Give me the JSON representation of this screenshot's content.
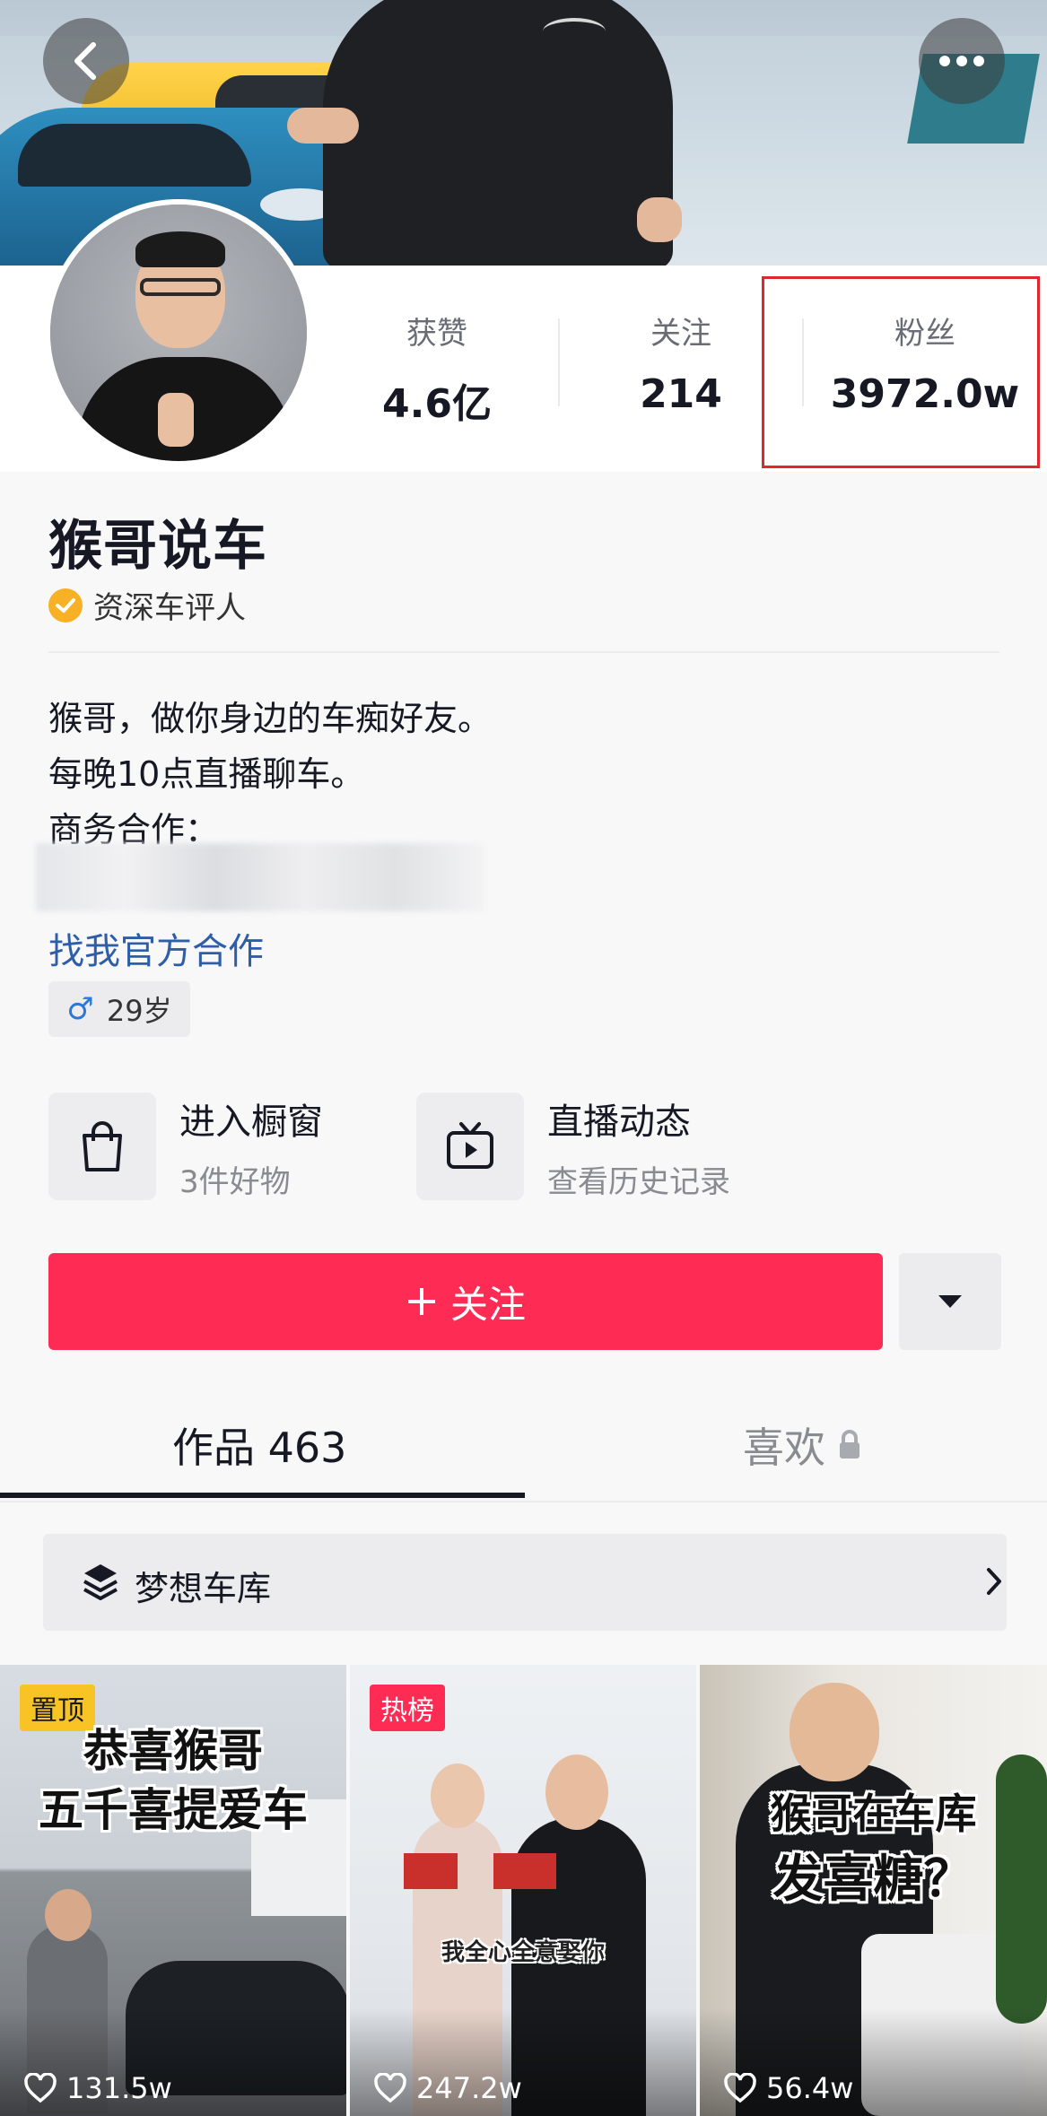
{
  "header": {
    "back_icon": "chevron-left-icon",
    "more_icon": "more-horizontal-icon"
  },
  "stats": [
    {
      "label": "获赞",
      "value": "4.6亿"
    },
    {
      "label": "关注",
      "value": "214"
    },
    {
      "label": "粉丝",
      "value": "3972.0w"
    }
  ],
  "profile": {
    "name": "猴哥说车",
    "verification": "资深车评人",
    "bio_lines": [
      "猴哥，做你身边的车痴好友。",
      "每晚10点直播聊车。",
      "商务合作："
    ],
    "official_link": "找我官方合作",
    "age": "29岁"
  },
  "shortcuts": [
    {
      "title": "进入橱窗",
      "subtitle": "3件好物"
    },
    {
      "title": "直播动态",
      "subtitle": "查看历史记录"
    }
  ],
  "actions": {
    "follow_label": "关注"
  },
  "tabs": {
    "works": "作品 463",
    "likes": "喜欢"
  },
  "collection": {
    "label": "梦想车库"
  },
  "videos": [
    {
      "tag": "置顶",
      "caption_lines": [
        "恭喜猴哥",
        "五千喜提爱车"
      ],
      "likes": "131.5w"
    },
    {
      "tag": "热榜",
      "caption_lines": [
        "我全心全意娶你"
      ],
      "likes": "247.2w"
    },
    {
      "tag": "",
      "caption_lines": [
        "猴哥在车库",
        "发喜糖？"
      ],
      "likes": "56.4w"
    }
  ],
  "colors": {
    "accent": "#fe2c55",
    "link": "#2e5ea8",
    "highlight_box": "#e0262e",
    "verify_badge": "#f8b124",
    "pin_tag": "#f7c325"
  }
}
